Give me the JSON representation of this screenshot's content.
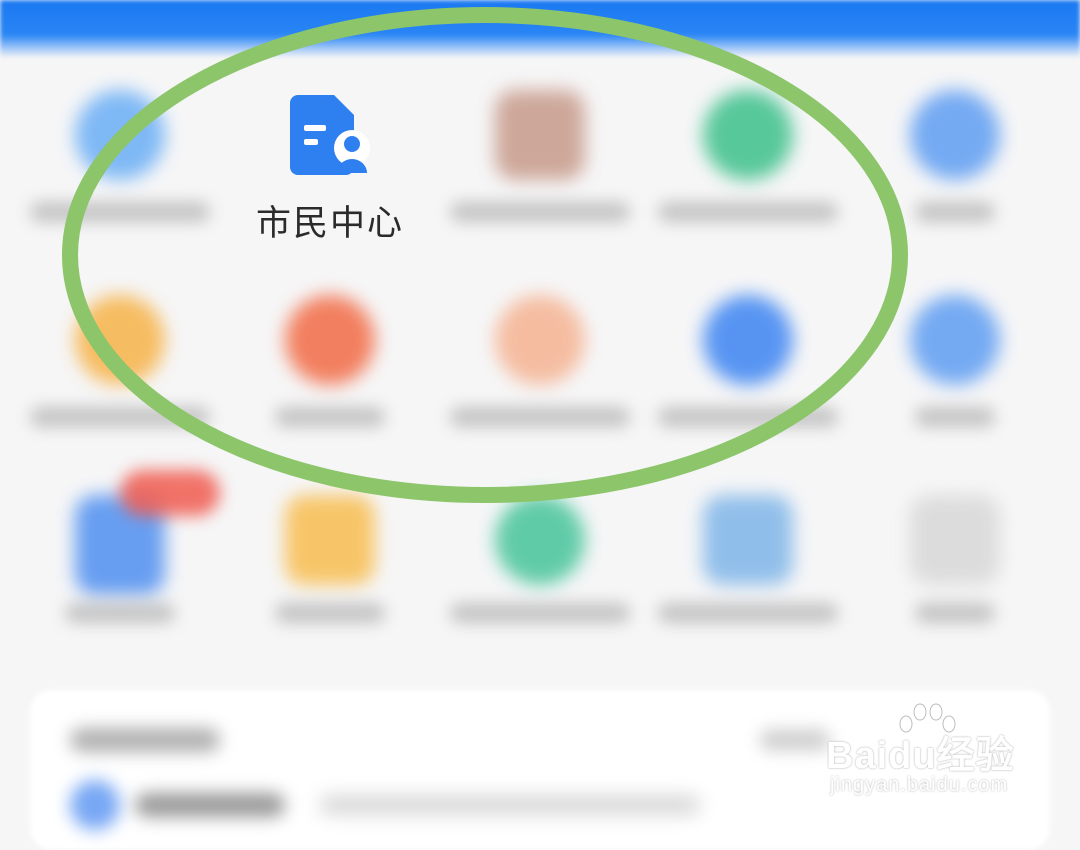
{
  "focused_app": {
    "label": "市民中心",
    "icon": "document-person-icon",
    "icon_color": "#2e7ff0"
  },
  "blurred_apps": [
    {
      "color": "#6aaef5",
      "shape": "round",
      "name": "app-1"
    },
    {
      "color": "#c79a8a",
      "shape": "round",
      "name": "app-3"
    },
    {
      "color": "#3cc08a",
      "shape": "round",
      "name": "app-4"
    },
    {
      "color": "#5e9df2",
      "shape": "round",
      "name": "app-5"
    },
    {
      "color": "#f7b247",
      "shape": "round",
      "name": "app-6"
    },
    {
      "color": "#f26b45",
      "shape": "round",
      "name": "app-7"
    },
    {
      "color": "#f5b392",
      "shape": "round",
      "name": "app-8"
    },
    {
      "color": "#3c84f2",
      "shape": "round",
      "name": "app-9"
    },
    {
      "color": "#5e9df2",
      "shape": "round",
      "name": "app-10"
    },
    {
      "color": "#4f8ff0",
      "shape": "square",
      "name": "app-11"
    },
    {
      "color": "#f8bd4f",
      "shape": "square",
      "name": "app-12"
    },
    {
      "color": "#46c49a",
      "shape": "round",
      "name": "app-13"
    },
    {
      "color": "#7fb5e8",
      "shape": "square",
      "name": "app-14"
    },
    {
      "color": "#d8d8d8",
      "shape": "square",
      "name": "app-15"
    }
  ],
  "highlight_ellipse_color": "#8cc56a",
  "header_color": "#1a78f2",
  "watermark": {
    "brand": "Baidu经验",
    "url": "jingyan.baidu.com"
  }
}
